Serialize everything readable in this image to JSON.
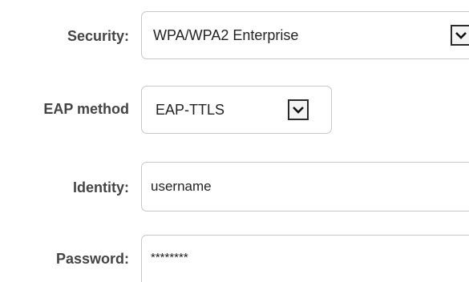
{
  "security": {
    "label": "Security:",
    "selected": "WPA/WPA2 Enterprise"
  },
  "eap": {
    "label": "EAP method",
    "selected": "EAP-TTLS"
  },
  "identity": {
    "label": "Identity:",
    "value": "username"
  },
  "password": {
    "label": "Password:",
    "value": "********"
  }
}
